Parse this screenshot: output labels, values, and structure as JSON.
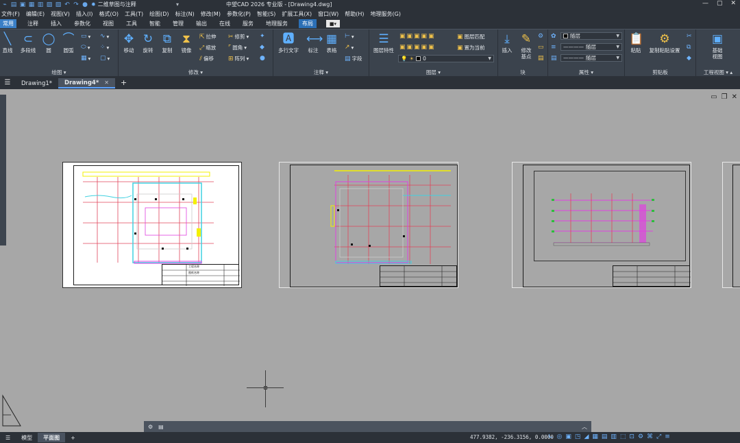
{
  "app": {
    "title": "中望CAD 2026 专业版 - [Drawing4.dwg]",
    "workspace": "二维草图与注释",
    "window_controls": [
      "—",
      "▢",
      "✕"
    ]
  },
  "quick_access": [
    "app-logo-icon",
    "new-icon",
    "open-icon",
    "save-icon",
    "saveas-icon",
    "print-icon",
    "plot-preview-icon",
    "undo-icon",
    "redo-icon",
    "help-icon"
  ],
  "menu": [
    "文件(F)",
    "编辑(E)",
    "视图(V)",
    "插入(I)",
    "格式(O)",
    "工具(T)",
    "绘图(D)",
    "标注(N)",
    "修改(M)",
    "参数化(P)",
    "智能(S)",
    "扩展工具(X)",
    "窗口(W)",
    "帮助(H)",
    "地理服务(G)"
  ],
  "ribbon_tabs": {
    "items": [
      "常用",
      "注释",
      "插入",
      "参数化",
      "视图",
      "工具",
      "智能",
      "管理",
      "输出",
      "在线",
      "服务",
      "地理服务",
      "布局"
    ],
    "active": "布局"
  },
  "ribbon": {
    "draw": {
      "title": "绘图",
      "line": "直线",
      "polyline": "多段线",
      "circle": "圆",
      "arc": "圆弧"
    },
    "modify": {
      "title": "修改",
      "move": "移动",
      "rotate": "旋转",
      "copy": "复制",
      "mirror": "镜像",
      "stretch": "拉伸",
      "scale": "缩放",
      "offset": "偏移",
      "trim": "修剪",
      "fillet": "圆角",
      "array": "阵列"
    },
    "annotation": {
      "title": "注释",
      "mtext": "多行文字",
      "dimension": "标注",
      "table": "表格",
      "field": "字段"
    },
    "layers": {
      "title": "图层",
      "properties": "图层特性",
      "match": "图层匹配",
      "set_current": "置为当前",
      "current_layer": "0"
    },
    "block": {
      "title": "块",
      "insert": "插入",
      "base_point": "修改\n基点"
    },
    "properties": {
      "title": "属性",
      "color": "随层",
      "linetype": "随层",
      "lineweight": "随层"
    },
    "clipboard": {
      "title": "剪贴板",
      "paste": "粘贴",
      "copy_paste_settings": "复制粘贴设置"
    },
    "project_view": {
      "title": "工程视图",
      "base_view": "基础\n视图"
    }
  },
  "doc_tabs": {
    "items": [
      "Drawing1*",
      "Drawing4*"
    ],
    "active": "Drawing4*",
    "close": "✕",
    "new": "+"
  },
  "sheets": {
    "titleblock_text": "工程名称",
    "title_sub": "图纸名称"
  },
  "status": {
    "tabs": [
      "模型",
      "平面图"
    ],
    "active": "平面图",
    "add": "+",
    "coords": "477.9382, -236.3156, 0.0000"
  },
  "colors": {
    "accent": "#2b6fb6",
    "chrome": "#2c3138",
    "ribbon": "#3b434d",
    "canvas": "#a7a7a7"
  }
}
